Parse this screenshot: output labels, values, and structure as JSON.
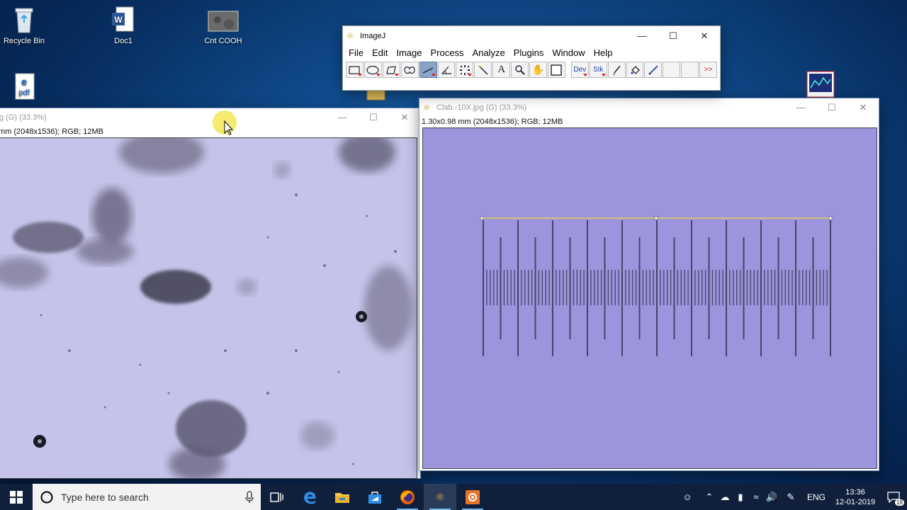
{
  "desktop": {
    "icons": [
      {
        "label": "Recycle Bin"
      },
      {
        "label": "Doc1"
      },
      {
        "label": "Cnt COOH"
      },
      {
        "label": ""
      }
    ]
  },
  "imagej": {
    "title": "ImageJ",
    "menu": [
      "File",
      "Edit",
      "Image",
      "Process",
      "Analyze",
      "Plugins",
      "Window",
      "Help"
    ],
    "tools": {
      "dev": "Dev",
      "stk": "Stk",
      "more": ">>"
    }
  },
  "left_window": {
    "title": "g (G) (33.3%)",
    "info": "mm (2048x1536); RGB; 12MB"
  },
  "right_window": {
    "title": "Clab.-10X.jpg (G) (33.3%)",
    "info": "1.30x0.98 mm (2048x1536); RGB; 12MB"
  },
  "taskbar": {
    "search_placeholder": "Type here to search",
    "language": "ENG",
    "time": "13:36",
    "date": "12-01-2019",
    "notification_count": "19"
  },
  "colors": {
    "accent": "#76b9ed",
    "taskbar": "#10203c",
    "selection_line": "#e8d24a",
    "canvas_left": "#c9c6ec",
    "canvas_right": "#9c94dd"
  }
}
